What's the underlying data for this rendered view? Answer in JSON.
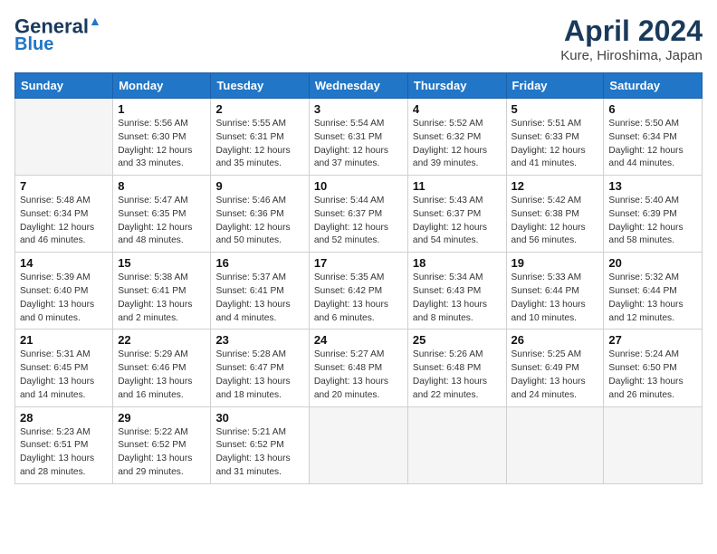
{
  "header": {
    "logo_line1": "General",
    "logo_line2": "Blue",
    "month_title": "April 2024",
    "location": "Kure, Hiroshima, Japan"
  },
  "weekdays": [
    "Sunday",
    "Monday",
    "Tuesday",
    "Wednesday",
    "Thursday",
    "Friday",
    "Saturday"
  ],
  "weeks": [
    [
      {
        "day": "",
        "sunrise": "",
        "sunset": "",
        "daylight": ""
      },
      {
        "day": "1",
        "sunrise": "Sunrise: 5:56 AM",
        "sunset": "Sunset: 6:30 PM",
        "daylight": "Daylight: 12 hours and 33 minutes."
      },
      {
        "day": "2",
        "sunrise": "Sunrise: 5:55 AM",
        "sunset": "Sunset: 6:31 PM",
        "daylight": "Daylight: 12 hours and 35 minutes."
      },
      {
        "day": "3",
        "sunrise": "Sunrise: 5:54 AM",
        "sunset": "Sunset: 6:31 PM",
        "daylight": "Daylight: 12 hours and 37 minutes."
      },
      {
        "day": "4",
        "sunrise": "Sunrise: 5:52 AM",
        "sunset": "Sunset: 6:32 PM",
        "daylight": "Daylight: 12 hours and 39 minutes."
      },
      {
        "day": "5",
        "sunrise": "Sunrise: 5:51 AM",
        "sunset": "Sunset: 6:33 PM",
        "daylight": "Daylight: 12 hours and 41 minutes."
      },
      {
        "day": "6",
        "sunrise": "Sunrise: 5:50 AM",
        "sunset": "Sunset: 6:34 PM",
        "daylight": "Daylight: 12 hours and 44 minutes."
      }
    ],
    [
      {
        "day": "7",
        "sunrise": "Sunrise: 5:48 AM",
        "sunset": "Sunset: 6:34 PM",
        "daylight": "Daylight: 12 hours and 46 minutes."
      },
      {
        "day": "8",
        "sunrise": "Sunrise: 5:47 AM",
        "sunset": "Sunset: 6:35 PM",
        "daylight": "Daylight: 12 hours and 48 minutes."
      },
      {
        "day": "9",
        "sunrise": "Sunrise: 5:46 AM",
        "sunset": "Sunset: 6:36 PM",
        "daylight": "Daylight: 12 hours and 50 minutes."
      },
      {
        "day": "10",
        "sunrise": "Sunrise: 5:44 AM",
        "sunset": "Sunset: 6:37 PM",
        "daylight": "Daylight: 12 hours and 52 minutes."
      },
      {
        "day": "11",
        "sunrise": "Sunrise: 5:43 AM",
        "sunset": "Sunset: 6:37 PM",
        "daylight": "Daylight: 12 hours and 54 minutes."
      },
      {
        "day": "12",
        "sunrise": "Sunrise: 5:42 AM",
        "sunset": "Sunset: 6:38 PM",
        "daylight": "Daylight: 12 hours and 56 minutes."
      },
      {
        "day": "13",
        "sunrise": "Sunrise: 5:40 AM",
        "sunset": "Sunset: 6:39 PM",
        "daylight": "Daylight: 12 hours and 58 minutes."
      }
    ],
    [
      {
        "day": "14",
        "sunrise": "Sunrise: 5:39 AM",
        "sunset": "Sunset: 6:40 PM",
        "daylight": "Daylight: 13 hours and 0 minutes."
      },
      {
        "day": "15",
        "sunrise": "Sunrise: 5:38 AM",
        "sunset": "Sunset: 6:41 PM",
        "daylight": "Daylight: 13 hours and 2 minutes."
      },
      {
        "day": "16",
        "sunrise": "Sunrise: 5:37 AM",
        "sunset": "Sunset: 6:41 PM",
        "daylight": "Daylight: 13 hours and 4 minutes."
      },
      {
        "day": "17",
        "sunrise": "Sunrise: 5:35 AM",
        "sunset": "Sunset: 6:42 PM",
        "daylight": "Daylight: 13 hours and 6 minutes."
      },
      {
        "day": "18",
        "sunrise": "Sunrise: 5:34 AM",
        "sunset": "Sunset: 6:43 PM",
        "daylight": "Daylight: 13 hours and 8 minutes."
      },
      {
        "day": "19",
        "sunrise": "Sunrise: 5:33 AM",
        "sunset": "Sunset: 6:44 PM",
        "daylight": "Daylight: 13 hours and 10 minutes."
      },
      {
        "day": "20",
        "sunrise": "Sunrise: 5:32 AM",
        "sunset": "Sunset: 6:44 PM",
        "daylight": "Daylight: 13 hours and 12 minutes."
      }
    ],
    [
      {
        "day": "21",
        "sunrise": "Sunrise: 5:31 AM",
        "sunset": "Sunset: 6:45 PM",
        "daylight": "Daylight: 13 hours and 14 minutes."
      },
      {
        "day": "22",
        "sunrise": "Sunrise: 5:29 AM",
        "sunset": "Sunset: 6:46 PM",
        "daylight": "Daylight: 13 hours and 16 minutes."
      },
      {
        "day": "23",
        "sunrise": "Sunrise: 5:28 AM",
        "sunset": "Sunset: 6:47 PM",
        "daylight": "Daylight: 13 hours and 18 minutes."
      },
      {
        "day": "24",
        "sunrise": "Sunrise: 5:27 AM",
        "sunset": "Sunset: 6:48 PM",
        "daylight": "Daylight: 13 hours and 20 minutes."
      },
      {
        "day": "25",
        "sunrise": "Sunrise: 5:26 AM",
        "sunset": "Sunset: 6:48 PM",
        "daylight": "Daylight: 13 hours and 22 minutes."
      },
      {
        "day": "26",
        "sunrise": "Sunrise: 5:25 AM",
        "sunset": "Sunset: 6:49 PM",
        "daylight": "Daylight: 13 hours and 24 minutes."
      },
      {
        "day": "27",
        "sunrise": "Sunrise: 5:24 AM",
        "sunset": "Sunset: 6:50 PM",
        "daylight": "Daylight: 13 hours and 26 minutes."
      }
    ],
    [
      {
        "day": "28",
        "sunrise": "Sunrise: 5:23 AM",
        "sunset": "Sunset: 6:51 PM",
        "daylight": "Daylight: 13 hours and 28 minutes."
      },
      {
        "day": "29",
        "sunrise": "Sunrise: 5:22 AM",
        "sunset": "Sunset: 6:52 PM",
        "daylight": "Daylight: 13 hours and 29 minutes."
      },
      {
        "day": "30",
        "sunrise": "Sunrise: 5:21 AM",
        "sunset": "Sunset: 6:52 PM",
        "daylight": "Daylight: 13 hours and 31 minutes."
      },
      {
        "day": "",
        "sunrise": "",
        "sunset": "",
        "daylight": ""
      },
      {
        "day": "",
        "sunrise": "",
        "sunset": "",
        "daylight": ""
      },
      {
        "day": "",
        "sunrise": "",
        "sunset": "",
        "daylight": ""
      },
      {
        "day": "",
        "sunrise": "",
        "sunset": "",
        "daylight": ""
      }
    ]
  ]
}
